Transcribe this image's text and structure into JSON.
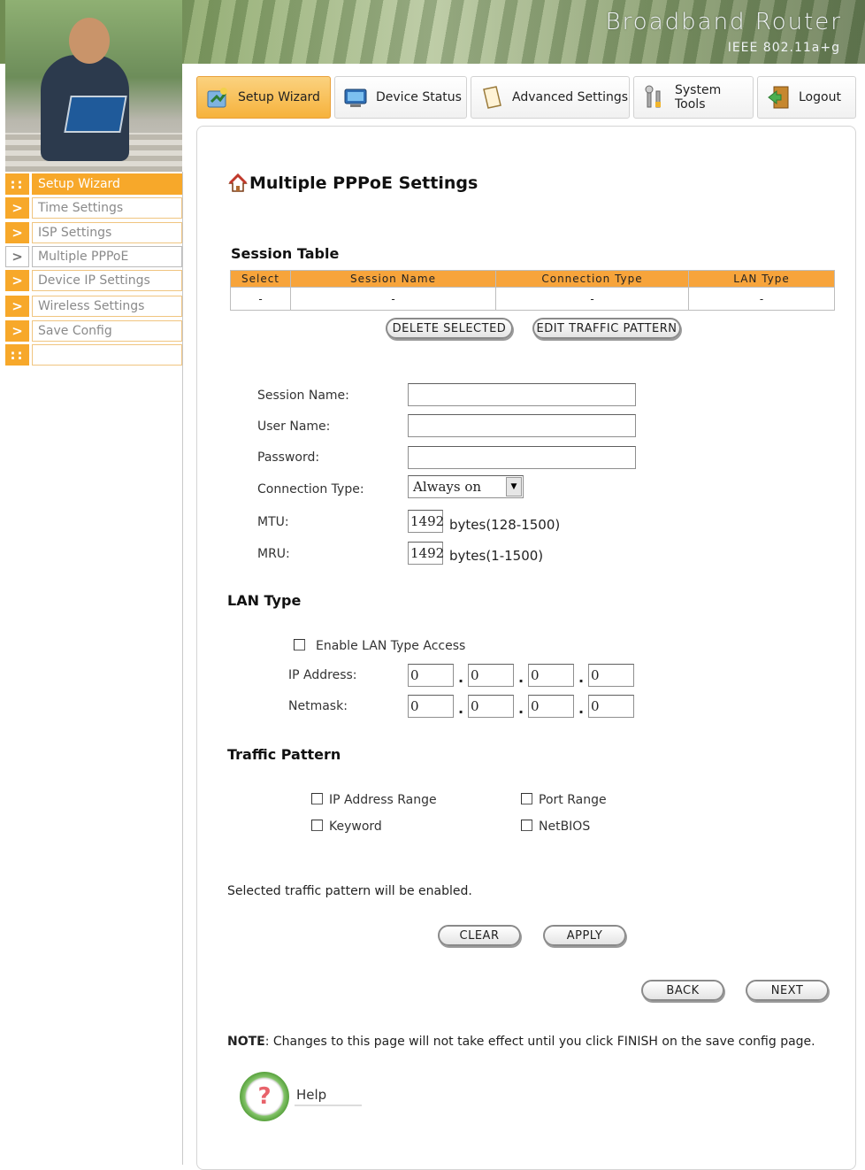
{
  "header": {
    "brand_title": "Broadband Router",
    "brand_subtitle": "IEEE 802.11a+g"
  },
  "tabs": [
    {
      "label": "Setup Wizard",
      "icon": "wizard-icon",
      "selected": true
    },
    {
      "label": "Device Status",
      "icon": "monitor-icon",
      "selected": false
    },
    {
      "label": "Advanced Settings",
      "icon": "document-icon",
      "selected": false
    },
    {
      "label": "System Tools",
      "icon": "tools-icon",
      "selected": false
    },
    {
      "label": "Logout",
      "icon": "exit-door-icon",
      "selected": false
    }
  ],
  "sidebar": {
    "items": [
      {
        "label": "Setup Wizard",
        "marker": "::"
      },
      {
        "label": "Time Settings",
        "marker": ">"
      },
      {
        "label": "ISP Settings",
        "marker": ">"
      },
      {
        "label": "Multiple PPPoE",
        "marker": ">"
      },
      {
        "label": "Device IP Settings",
        "marker": ">"
      },
      {
        "label": "Wireless Settings",
        "marker": ">"
      },
      {
        "label": "Save Config",
        "marker": ">"
      },
      {
        "label": "",
        "marker": "::"
      }
    ],
    "active_index": 3
  },
  "page": {
    "title": "Multiple PPPoE Settings"
  },
  "session_table": {
    "heading": "Session Table",
    "columns": [
      "Select",
      "Session Name",
      "Connection Type",
      "LAN Type"
    ],
    "rows": [
      [
        "-",
        "-",
        "-",
        "-"
      ]
    ],
    "delete_button": "DELETE SELECTED",
    "edit_button": "EDIT TRAFFIC PATTERN"
  },
  "form": {
    "session_name_label": "Session Name:",
    "session_name_value": "",
    "user_name_label": "User Name:",
    "user_name_value": "",
    "password_label": "Password:",
    "password_value": "",
    "connection_type_label": "Connection Type:",
    "connection_type_value": "Always on",
    "mtu_label": "MTU:",
    "mtu_value": "1492",
    "mtu_unit": "bytes(128-1500)",
    "mru_label": "MRU:",
    "mru_value": "1492",
    "mru_unit": "bytes(1-1500)"
  },
  "lan_type": {
    "heading": "LAN Type",
    "enable_label": "Enable LAN Type Access",
    "enable_checked": false,
    "ip_label": "IP Address:",
    "ip_octets": [
      "0",
      "0",
      "0",
      "0"
    ],
    "netmask_label": "Netmask:",
    "netmask_octets": [
      "0",
      "0",
      "0",
      "0"
    ]
  },
  "traffic_pattern": {
    "heading": "Traffic Pattern",
    "options": [
      {
        "label": "IP Address Range",
        "checked": false
      },
      {
        "label": "Port Range",
        "checked": false
      },
      {
        "label": "Keyword",
        "checked": false
      },
      {
        "label": "NetBIOS",
        "checked": false
      }
    ],
    "info": "Selected traffic pattern will be enabled."
  },
  "buttons": {
    "clear": "CLEAR",
    "apply": "APPLY",
    "back": "BACK",
    "next": "NEXT"
  },
  "note": {
    "prefix": "NOTE",
    "text": ": Changes to this page will not take effect until you click FINISH on the save config page."
  },
  "help": {
    "label": "Help",
    "icon": "question-mark-icon"
  },
  "colors": {
    "accent_orange": "#f7a82a",
    "table_header": "#f7a43b"
  }
}
